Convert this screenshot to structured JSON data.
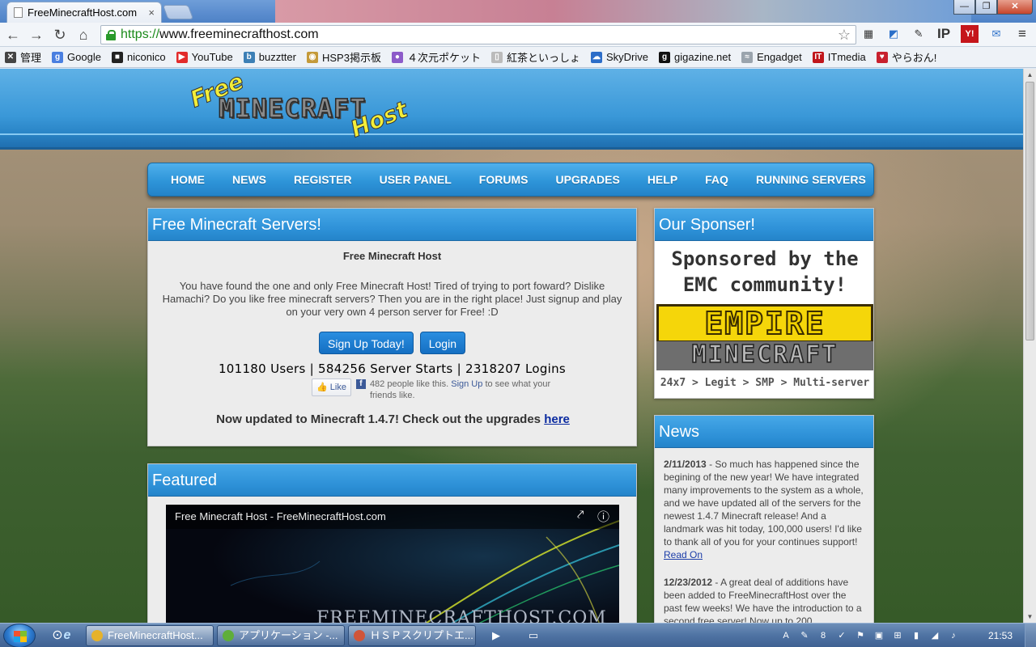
{
  "browser": {
    "tab_title": "FreeMinecraftHost.com",
    "tab_close": "×",
    "url_scheme": "https://",
    "url_rest": "www.freeminecrafthost.com",
    "nav": {
      "back": "←",
      "forward": "→",
      "reload": "↻",
      "home": "⌂",
      "star": "☆"
    },
    "window_controls": {
      "minimize": "—",
      "maximize": "❐",
      "close": "✕"
    },
    "extensions": [
      "▦",
      "◩",
      "✎",
      "IP",
      "Y!",
      "✉",
      "≡"
    ]
  },
  "bookmarks": [
    {
      "label": "管理",
      "icon": "tools-icon",
      "color": "#444444",
      "glyph": "✕"
    },
    {
      "label": "Google",
      "icon": "google-icon",
      "color": "#4a7fe0",
      "glyph": "g"
    },
    {
      "label": "niconico",
      "icon": "niconico-icon",
      "color": "#222222",
      "glyph": "■"
    },
    {
      "label": "YouTube",
      "icon": "youtube-icon",
      "color": "#e22b2b",
      "glyph": "▶"
    },
    {
      "label": "buzztter",
      "icon": "buzztter-icon",
      "color": "#3c7fb5",
      "glyph": "b"
    },
    {
      "label": "HSP3掲示板",
      "icon": "hsp3-icon",
      "color": "#c49a3a",
      "glyph": "◉"
    },
    {
      "label": "４次元ポケット",
      "icon": "pocket-icon",
      "color": "#8c5bc9",
      "glyph": "●"
    },
    {
      "label": "紅茶といっしょ",
      "icon": "page-icon",
      "color": "#bbbbbb",
      "glyph": "▯"
    },
    {
      "label": "SkyDrive",
      "icon": "skydrive-icon",
      "color": "#2c6dc8",
      "glyph": "☁"
    },
    {
      "label": "gigazine.net",
      "icon": "gigazine-icon",
      "color": "#111111",
      "glyph": "g"
    },
    {
      "label": "Engadget",
      "icon": "rss-icon",
      "color": "#9aa4ad",
      "glyph": "≈"
    },
    {
      "label": "ITmedia",
      "icon": "itmedia-icon",
      "color": "#c0161b",
      "glyph": "IT"
    },
    {
      "label": "やらおん!",
      "icon": "yaraon-icon",
      "color": "#c8202e",
      "glyph": "♥"
    }
  ],
  "site": {
    "logo": {
      "free": "Free",
      "main": "MINECRAFT",
      "host": "Host"
    },
    "nav": [
      "HOME",
      "NEWS",
      "REGISTER",
      "USER PANEL",
      "FORUMS",
      "UPGRADES",
      "HELP",
      "FAQ",
      "RUNNING SERVERS"
    ],
    "servers_panel": {
      "heading": "Free Minecraft Servers!",
      "title": "Free Minecraft Host",
      "body": "You have found the one and only Free Minecraft Host! Tired of trying to port foward? Dislike Hamachi? Do you like free minecraft servers? Then you are in the right place! Just signup and play on your very own 4 person server for Free! :D",
      "signup_button": "Sign Up Today!",
      "login_button": "Login",
      "stats": "101180 Users | 584256 Server Starts | 2318207 Logins",
      "like_button": "👍 Like",
      "like_count_text": "482 people like this.",
      "like_signup": "Sign Up",
      "like_suffix": "to see what your friends like.",
      "update_text": "Now updated to Minecraft 1.4.7! Check out the upgrades",
      "update_link": "here"
    },
    "featured_panel": {
      "heading": "Featured",
      "video_title": "Free Minecraft Host - FreeMinecraftHost.com",
      "share_icon": "⤤",
      "info_icon": "ⓘ",
      "video_brand": "FREEMINECRAFTHOST.COM"
    },
    "sponsor_panel": {
      "heading": "Our Sponser!",
      "line1": "Sponsored by the",
      "line2": "EMC community!",
      "empire": "EMPIRE",
      "minecraft": "MINECRAFT",
      "tagline": "24x7 > Legit > SMP > Multi-server"
    },
    "news_panel": {
      "heading": "News",
      "items": [
        {
          "date": "2/11/2013",
          "text": " - So much has happened since the begining of the new year! We have integrated many improvements to the system as a whole, and we have updated all of the servers for the newest 1.4.7 Minecraft release! And a landmark was hit today, 100,000 users! I'd like to thank all of you for your continues support!",
          "link": " Read On"
        },
        {
          "date": "12/23/2012",
          "text": " - A great deal of additions have been added to FreeMinecraftHost over the past few weeks! We have the introduction to a second free server! Now up to 200",
          "link": ""
        }
      ]
    }
  },
  "taskbar": {
    "items": [
      {
        "label": "FreeMinecraftHost...",
        "icon": "chrome-icon",
        "color": "#e6b22b",
        "active": true
      },
      {
        "label": "アプリケーション -...",
        "icon": "app-icon",
        "color": "#5fae3a",
        "active": false
      },
      {
        "label": "ＨＳＰスクリプトエ...",
        "icon": "hsp-editor-icon",
        "color": "#d0553a",
        "active": false
      }
    ],
    "pinned": [
      "⊙",
      "e"
    ],
    "tray": [
      "A",
      "✎",
      "8",
      "✓",
      "⚑",
      "▣",
      "⊞",
      "▮",
      "◢",
      "♪"
    ],
    "clock": "21:53"
  }
}
